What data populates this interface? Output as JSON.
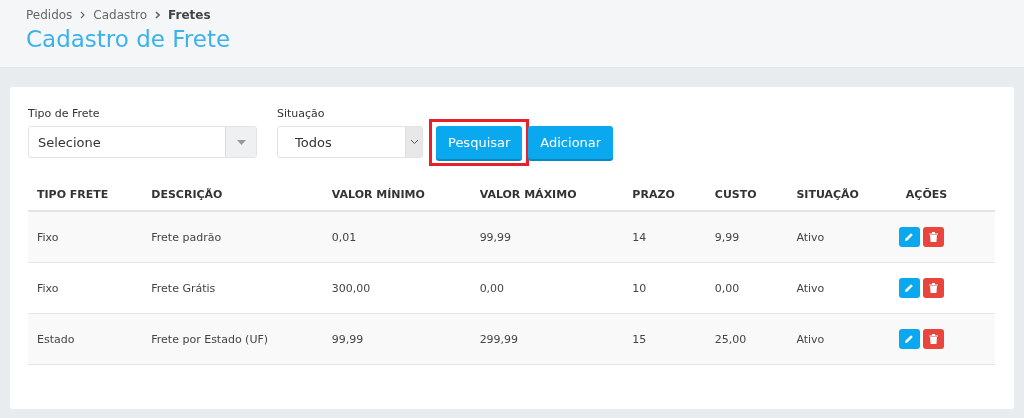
{
  "breadcrumb": [
    {
      "label": "Pedidos",
      "current": false
    },
    {
      "label": "Cadastro",
      "current": false
    },
    {
      "label": "Fretes",
      "current": true
    }
  ],
  "page_title": "Cadastro de Frete",
  "filters": [
    {
      "kind": "select",
      "label": "Tipo de Frete",
      "value": "Selecione"
    },
    {
      "kind": "native-select",
      "label": "Situação",
      "value": "Todos"
    }
  ],
  "buttons": [
    {
      "label": "Pesquisar",
      "highlighted": true
    },
    {
      "label": "Adicionar",
      "highlighted": false
    }
  ],
  "table": {
    "columns": [
      "TIPO FRETE",
      "DESCRIÇÃO",
      "VALOR MÍNIMO",
      "VALOR MÁXIMO",
      "PRAZO",
      "CUSTO",
      "SITUAÇÃO",
      "AÇÕES"
    ],
    "rows": [
      {
        "cells": [
          "Fixo",
          "Frete padrão",
          "0,01",
          "99,99",
          "14",
          "9,99",
          "Ativo"
        ]
      },
      {
        "cells": [
          "Fixo",
          "Frete Grátis",
          "300,00",
          "0,00",
          "10",
          "0,00",
          "Ativo"
        ]
      },
      {
        "cells": [
          "Estado",
          "Frete por Estado (UF)",
          "99,99",
          "299,99",
          "15",
          "25,00",
          "Ativo"
        ]
      }
    ]
  }
}
